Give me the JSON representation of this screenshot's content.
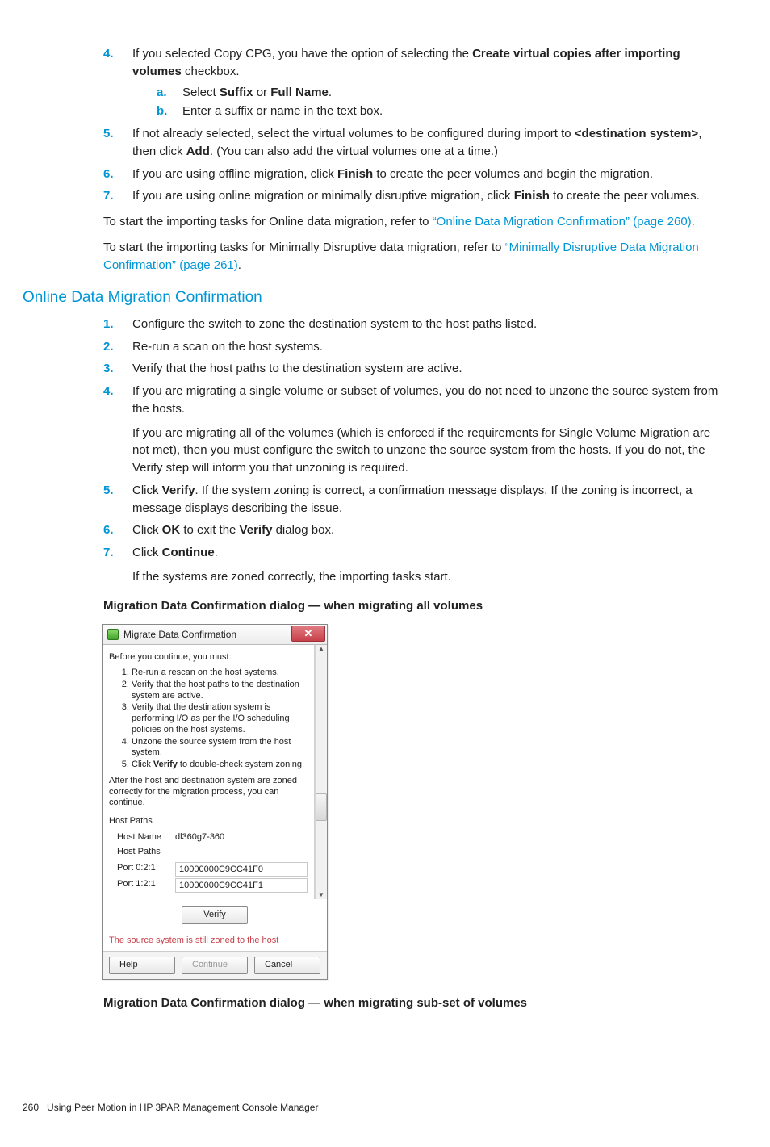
{
  "list1": {
    "i4": {
      "marker": "4.",
      "text_a": "If you selected Copy CPG, you have the option of selecting the ",
      "bold_a": "Create virtual copies after importing volumes",
      "text_b": " checkbox.",
      "sub": {
        "a": {
          "marker": "a.",
          "pre": "Select ",
          "b1": "Suffix",
          "mid": " or ",
          "b2": "Full Name",
          "post": "."
        },
        "b": {
          "marker": "b.",
          "text": "Enter a suffix or name in the text box."
        }
      }
    },
    "i5": {
      "marker": "5.",
      "text_a": "If not already selected, select the virtual volumes to be configured during import to ",
      "bold_a": "<destination system>",
      "text_b": ", then click ",
      "bold_b": "Add",
      "text_c": ". (You can also add the virtual volumes one at a time.)"
    },
    "i6": {
      "marker": "6.",
      "text_a": "If you are using offline migration, click ",
      "bold_a": "Finish",
      "text_b": " to create the peer volumes and begin the migration."
    },
    "i7": {
      "marker": "7.",
      "text_a": "If you are using online migration or minimally disruptive migration, click ",
      "bold_a": "Finish",
      "text_b": " to create the peer volumes."
    }
  },
  "paras": {
    "p1_a": "To start the importing tasks for Online data migration, refer to ",
    "p1_link": "“Online Data Migration Confirmation” (page 260)",
    "p1_b": ".",
    "p2_a": "To start the importing tasks for Minimally Disruptive data migration, refer to ",
    "p2_link": "“Minimally Disruptive Data Migration Confirmation” (page 261)",
    "p2_b": "."
  },
  "section_title": "Online Data Migration Confirmation",
  "list2": {
    "i1": {
      "marker": "1.",
      "text": "Configure the switch to zone the destination system to the host paths listed."
    },
    "i2": {
      "marker": "2.",
      "text": "Re-run a scan on the host systems."
    },
    "i3": {
      "marker": "3.",
      "text": "Verify that the host paths to the destination system are active."
    },
    "i4": {
      "marker": "4.",
      "text": "If you are migrating a single volume or subset of volumes, you do not need to unzone the source system from the hosts.",
      "para2": "If you are migrating all of the volumes (which is enforced if the requirements for Single Volume Migration are not met), then you must configure the switch to unzone the source system from the hosts. If you do not, the Verify step will inform you that unzoning is required."
    },
    "i5": {
      "marker": "5.",
      "pre": "Click ",
      "b1": "Verify",
      "post": ". If the system zoning is correct, a confirmation message displays. If the zoning is incorrect, a message displays describing the issue."
    },
    "i6": {
      "marker": "6.",
      "pre": "Click ",
      "b1": "OK",
      "mid": " to exit the ",
      "b2": "Verify",
      "post": " dialog box."
    },
    "i7": {
      "marker": "7.",
      "pre": "Click ",
      "b1": "Continue",
      "post": ".",
      "para2": "If the systems are zoned correctly, the importing tasks start."
    }
  },
  "caption1": "Migration Data Confirmation dialog — when migrating all volumes",
  "caption2": "Migration Data Confirmation dialog — when migrating sub-set of volumes",
  "dialog": {
    "title": "Migrate Data Confirmation",
    "before": "Before you continue, you must:",
    "steps": [
      "Re-run a rescan on the host systems.",
      "Verify that the host paths to the destination system are active.",
      "Verify that the destination system is performing I/O as per the I/O scheduling policies on the host systems.",
      "Unzone the source system from the host system.",
      "Click Verify to double-check system zoning."
    ],
    "step5_pre": "Click ",
    "step5_b": "Verify",
    "step5_post": " to double-check system zoning.",
    "after": "After the host and destination system are zoned correctly for the migration process, you can continue.",
    "host_paths_label": "Host Paths",
    "host_name_label": "Host Name",
    "host_name_value": "dl360g7-360",
    "host_paths_label2": "Host Paths",
    "ports": [
      {
        "label": "Port 0:2:1",
        "value": "10000000C9CC41F0"
      },
      {
        "label": "Port 1:2:1",
        "value": "10000000C9CC41F1"
      }
    ],
    "verify": "Verify",
    "status": "The source system is still zoned to the host",
    "help": "Help",
    "continue": "Continue",
    "cancel": "Cancel"
  },
  "footer": {
    "page": "260",
    "text": "Using Peer Motion in HP 3PAR Management Console Manager"
  }
}
